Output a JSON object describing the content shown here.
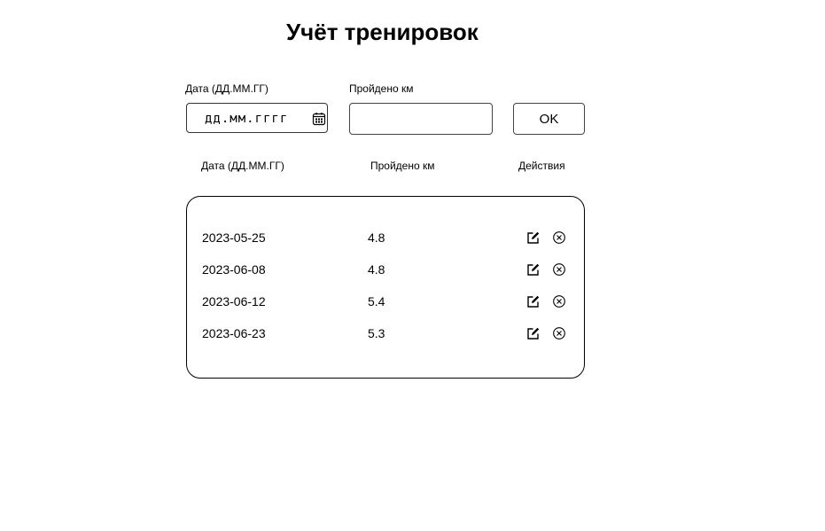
{
  "title": "Учёт тренировок",
  "form": {
    "date_label": "Дата (ДД.ММ.ГГ)",
    "date_placeholder": "дд.мм.гггг",
    "km_label": "Пройдено км",
    "km_value": "",
    "ok_label": "OK"
  },
  "table": {
    "headers": {
      "date": "Дата (ДД.ММ.ГГ)",
      "km": "Пройдено км",
      "actions": "Действия"
    },
    "rows": [
      {
        "date": "2023-05-25",
        "km": "4.8"
      },
      {
        "date": "2023-06-08",
        "km": "4.8"
      },
      {
        "date": "2023-06-12",
        "km": "5.4"
      },
      {
        "date": "2023-06-23",
        "km": "5.3"
      }
    ],
    "row_icons": [
      "edit-icon",
      "close-circle-icon"
    ]
  },
  "icons": {
    "date_picker": "calendar-icon"
  }
}
